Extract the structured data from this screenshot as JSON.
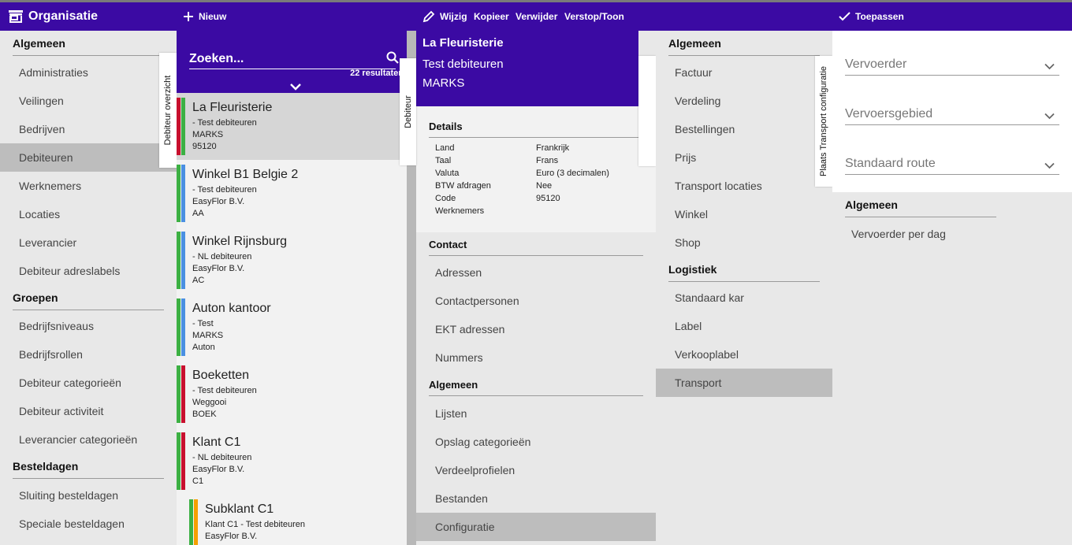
{
  "topbar": {
    "app_title": "Organisatie",
    "new_label": "Nieuw",
    "edit_label": "Wijzig",
    "copy_label": "Kopieer",
    "delete_label": "Verwijder",
    "hide_show_label": "Verstop/Toon",
    "apply_label": "Toepassen"
  },
  "organisatie_nav": {
    "sections": [
      {
        "title": "Algemeen",
        "items": [
          "Administraties",
          "Veilingen",
          "Bedrijven",
          "Debiteuren",
          "Werknemers",
          "Locaties",
          "Leverancier",
          "Debiteur adreslabels"
        ]
      },
      {
        "title": "Groepen",
        "items": [
          "Bedrijfsniveaus",
          "Bedrijfsrollen",
          "Debiteur categorieën",
          "Debiteur activiteit",
          "Leverancier categorieën"
        ]
      },
      {
        "title": "Besteldagen",
        "items": [
          "Sluiting besteldagen",
          "Speciale besteldagen"
        ]
      }
    ],
    "active_item": "Debiteuren",
    "side_tab": "Debiteur overzicht"
  },
  "debiteur_list": {
    "search_placeholder": "Zoeken...",
    "results_count": "22 resultaten",
    "items": [
      {
        "name": "La Fleuristerie",
        "line1": "- Test debiteuren",
        "line2": "MARKS",
        "line3": "95120",
        "colors": [
          "#c8102e",
          "#3cb043"
        ],
        "selected": true
      },
      {
        "name": "Winkel B1 Belgie 2",
        "line1": "- Test debiteuren",
        "line2": "EasyFlor B.V.",
        "line3": "AA",
        "colors": [
          "#3cb043",
          "#4a90e2"
        ]
      },
      {
        "name": "Winkel Rijnsburg",
        "line1": "- NL debiteuren",
        "line2": "EasyFlor B.V.",
        "line3": "AC",
        "colors": [
          "#3cb043",
          "#4a90e2"
        ]
      },
      {
        "name": "Auton kantoor",
        "line1": "- Test",
        "line2": "MARKS",
        "line3": "Auton",
        "colors": [
          "#3cb043",
          "#4a90e2"
        ]
      },
      {
        "name": "Boeketten",
        "line1": "- Test debiteuren",
        "line2": "Weggooi",
        "line3": "BOEK",
        "colors": [
          "#3cb043",
          "#c8102e"
        ]
      },
      {
        "name": "Klant C1",
        "line1": "- NL debiteuren",
        "line2": "EasyFlor B.V.",
        "line3": "C1",
        "colors": [
          "#3cb043",
          "#c8102e"
        ]
      },
      {
        "name": "Subklant C1",
        "line1": "Klant C1 - Test debiteuren",
        "line2": "EasyFlor B.V.",
        "line3": "",
        "colors": [
          "#3cb043",
          "#f5a000"
        ],
        "indent": true
      }
    ]
  },
  "debiteur_detail": {
    "title": "La Fleuristerie",
    "subtitle1": "Test debiteuren",
    "subtitle2": "MARKS",
    "side_tab": "Debiteur",
    "details_title": "Details",
    "details": [
      {
        "key": "Land",
        "value": "Frankrijk"
      },
      {
        "key": "Taal",
        "value": "Frans"
      },
      {
        "key": "Valuta",
        "value": "Euro (3 decimalen)"
      },
      {
        "key": "BTW afdragen",
        "value": "Nee"
      },
      {
        "key": "Code",
        "value": "95120"
      },
      {
        "key": "Werknemers",
        "value": ""
      }
    ],
    "sections": [
      {
        "title": "Contact",
        "items": [
          "Adressen",
          "Contactpersonen",
          "EKT adressen",
          "Nummers"
        ]
      },
      {
        "title": "Algemeen",
        "items": [
          "Lijsten",
          "Opslag categorieën",
          "Verdeelprofielen",
          "Bestanden",
          "Configuratie"
        ]
      }
    ],
    "active_item": "Configuratie"
  },
  "configuratie_nav": {
    "sections": [
      {
        "title": "Algemeen",
        "items": [
          "Factuur",
          "Verdeling",
          "Bestellingen",
          "Prijs",
          "Transport locaties",
          "Winkel",
          "Shop"
        ]
      },
      {
        "title": "Logistiek",
        "items": [
          "Standaard kar",
          "Label",
          "Verkooplabel",
          "Transport"
        ]
      }
    ],
    "active_item": "Transport",
    "side_tab": "Plaats Transport configuratie"
  },
  "transport_form": {
    "fields": [
      {
        "label": "Vervoerder"
      },
      {
        "label": "Vervoersgebied"
      },
      {
        "label": "Standaard route"
      }
    ],
    "section_title": "Algemeen",
    "items": [
      "Vervoerder per dag"
    ]
  },
  "colors": {
    "primary": "#3b0aa3",
    "active_row": "#bdbdbd"
  }
}
